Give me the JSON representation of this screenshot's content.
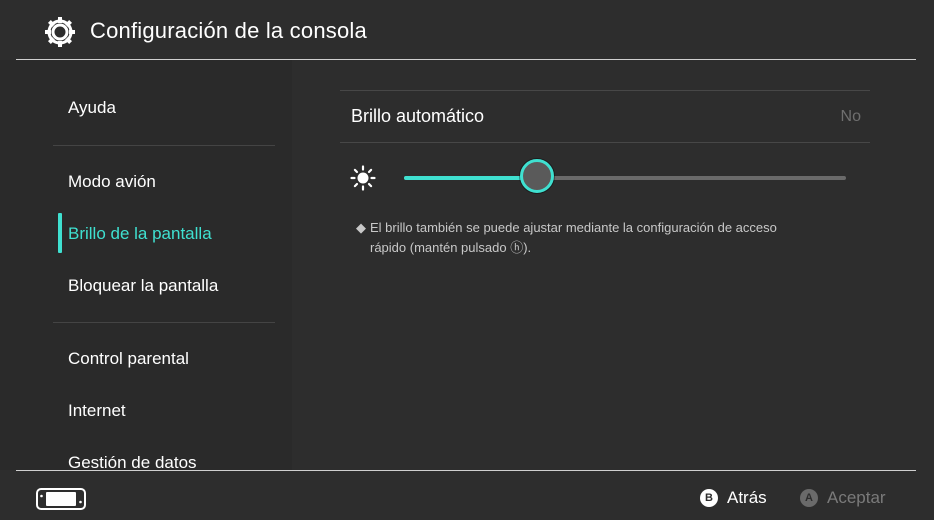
{
  "header": {
    "title": "Configuración de la consola",
    "icon": "gear-icon"
  },
  "sidebar": {
    "items": [
      {
        "label": "Ayuda"
      },
      {
        "label": "Modo avión"
      },
      {
        "label": "Brillo de la pantalla",
        "active": true
      },
      {
        "label": "Bloquear la pantalla"
      },
      {
        "label": "Control parental"
      },
      {
        "label": "Internet"
      },
      {
        "label": "Gestión de datos"
      }
    ]
  },
  "main": {
    "auto_brightness": {
      "label": "Brillo automático",
      "value": "No"
    },
    "brightness_slider": {
      "icon": "sun-icon",
      "level": 0.3
    },
    "note": {
      "bullet": "◆",
      "line1": "El brillo también se puede ajustar mediante la configuración de acceso",
      "line2": "rápido (mantén pulsado ⓗ)."
    }
  },
  "footer": {
    "console_icon": "console-icon",
    "back": {
      "button": "B",
      "label": "Atrás"
    },
    "accept": {
      "button": "A",
      "label": "Aceptar"
    }
  },
  "colors": {
    "accent": "#3fe0d0",
    "background": "#2d2d2d",
    "disabled": "#7a7a7a"
  }
}
